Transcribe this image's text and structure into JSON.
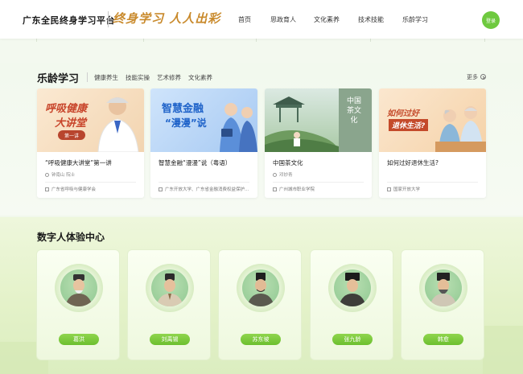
{
  "header": {
    "site_title": "广东全民终身学习平台",
    "slogan": "终身学习 人人出彩",
    "nav": [
      "首页",
      "思政育人",
      "文化素养",
      "技术技能",
      "乐龄学习"
    ],
    "login_label": "登录"
  },
  "learning": {
    "title": "乐龄学习",
    "tabs": [
      "健康养生",
      "技能实操",
      "艺术修养",
      "文化素养"
    ],
    "more_label": "更多",
    "cards": [
      {
        "title": "“呼吸健康大讲堂”第一讲",
        "author": "钟南山 院士",
        "org": "广东省呼吸与健康学会",
        "img_text_1": "呼吸健康",
        "img_text_2": "大讲堂",
        "img_text_3": "第一讲"
      },
      {
        "title": "智慧金融“漫漫”说（粤语）",
        "author": "",
        "org": "广东开放大学、广东省金融消费权益保护...",
        "img_text_1": "智慧金融",
        "img_text_2": "“漫漫”说"
      },
      {
        "title": "中国茶文化",
        "author": "邓妙青",
        "org": "广州城市职业学院",
        "img_text_1": "中国茶文化"
      },
      {
        "title": "如何过好退休生活?",
        "author": "",
        "org": "国家开放大学",
        "img_text_1": "如何过好",
        "img_text_2": "退休生活?"
      }
    ]
  },
  "digital": {
    "title": "数字人体验中心",
    "persons": [
      "葛洪",
      "刘禹锡",
      "苏东坡",
      "张九龄",
      "韩愈"
    ]
  },
  "colors": {
    "accent_green": "#6ec93f",
    "slogan_gold": "#c98a2c",
    "card_title_blue": "#2a6fd6"
  }
}
